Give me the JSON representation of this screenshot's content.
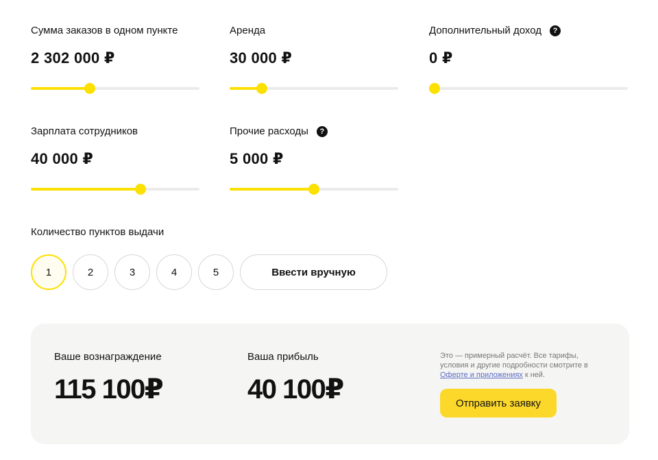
{
  "fields": {
    "orders_sum": {
      "label": "Сумма заказов в одном пункте",
      "value": "2 302 000 ₽",
      "level": 0.34
    },
    "rent": {
      "label": "Аренда",
      "value": "30 000 ₽",
      "level": 0.17
    },
    "extra_income": {
      "label": "Дополнительный доход",
      "value": "0 ₽",
      "level": 0.0,
      "help_icon": "?"
    },
    "salary": {
      "label": "Зарплата сотрудников",
      "value": "40 000 ₽",
      "level": 0.66
    },
    "other": {
      "label": "Прочие расходы",
      "value": "5 000 ₽",
      "level": 0.5,
      "help_icon": "?"
    }
  },
  "points": {
    "label": "Количество пунктов выдачи",
    "options": [
      "1",
      "2",
      "3",
      "4",
      "5"
    ],
    "selected": "1",
    "manual_label": "Ввести вручную"
  },
  "result": {
    "reward_label": "Ваше вознаграждение",
    "reward_value": "115 100₽",
    "profit_label": "Ваша прибыль",
    "profit_value": "40 100₽",
    "disclaimer_text": "Это — примерный расчёт. Все тарифы, условия и другие подробности смотрите в ",
    "disclaimer_link": "Оферте и приложениях",
    "disclaimer_tail": " к ней.",
    "submit_label": "Отправить заявку"
  },
  "colors": {
    "accent": "#fce000",
    "button": "#fcd82a",
    "track": "#ebebeb",
    "card_bg": "#f5f5f4",
    "link": "#5c6cc4"
  }
}
